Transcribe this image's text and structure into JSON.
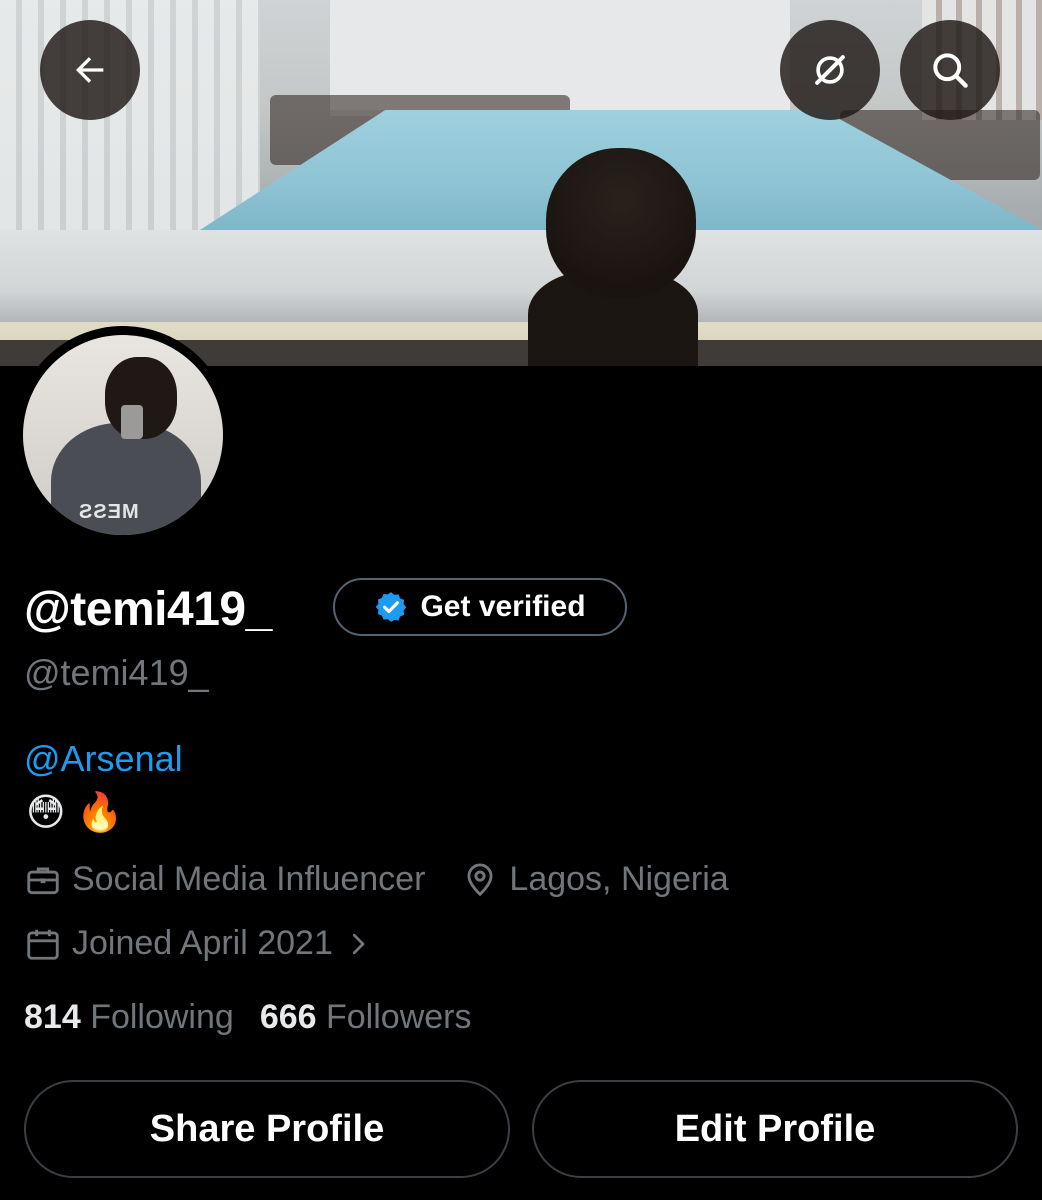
{
  "header": {
    "back_icon": "arrow-left-icon",
    "actions": [
      {
        "icon": "grok-icon"
      },
      {
        "icon": "search-icon"
      }
    ]
  },
  "profile": {
    "display_name": "@temi419_",
    "verify_label": "Get verified",
    "verify_icon": "verified-badge-icon",
    "handle": "@temi419_",
    "bio_link": "@Arsenal",
    "bio_emojis": "😳 🔥",
    "profession": "Social Media Influencer",
    "location": "Lagos, Nigeria",
    "joined": "Joined April 2021",
    "following_count": "814",
    "following_label": "Following",
    "followers_count": "666",
    "followers_label": "Followers"
  },
  "buttons": {
    "share": "Share Profile",
    "edit": "Edit Profile"
  },
  "colors": {
    "background": "#000000",
    "link": "#1d9bf0",
    "muted": "#71767b",
    "badge": "#1d9bf0"
  }
}
